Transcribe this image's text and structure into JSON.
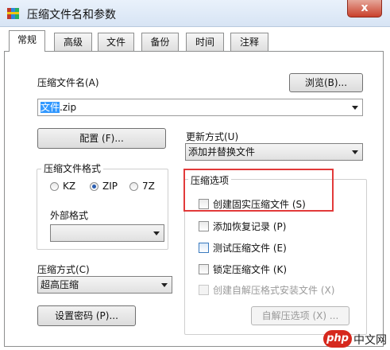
{
  "window": {
    "title": "压缩文件名和参数",
    "close_glyph": "x"
  },
  "tabs": [
    "常规",
    "高级",
    "文件",
    "备份",
    "时间",
    "注释"
  ],
  "filename": {
    "label": "压缩文件名(A)",
    "browse_button": "浏览(B)...",
    "value_selected": "文件",
    "value_rest": ".zip"
  },
  "config_button": "配置 (F)...",
  "update_mode": {
    "label": "更新方式(U)",
    "value": "添加并替换文件"
  },
  "format": {
    "group_title": "压缩文件格式",
    "options": [
      "KZ",
      "ZIP",
      "7Z"
    ],
    "selected": "ZIP"
  },
  "external_format": {
    "label": "外部格式",
    "value": ""
  },
  "method": {
    "label": "压缩方式(C)",
    "value": "超高压缩"
  },
  "password_button": "设置密码 (P)...",
  "options": {
    "group_title": "压缩选项",
    "items": [
      {
        "label": "创建固实压缩文件 (S)",
        "checked": false,
        "disabled": false
      },
      {
        "label": "添加恢复记录 (P)",
        "checked": false,
        "disabled": false
      },
      {
        "label": "测试压缩文件 (E)",
        "checked": false,
        "disabled": false
      },
      {
        "label": "锁定压缩文件 (K)",
        "checked": false,
        "disabled": false
      },
      {
        "label": "创建自解压格式安装文件 (X)",
        "checked": false,
        "disabled": true
      }
    ],
    "sfx_button": "自解压选项 (X) ..."
  },
  "watermark": {
    "logo": "php",
    "text": "中文网"
  }
}
